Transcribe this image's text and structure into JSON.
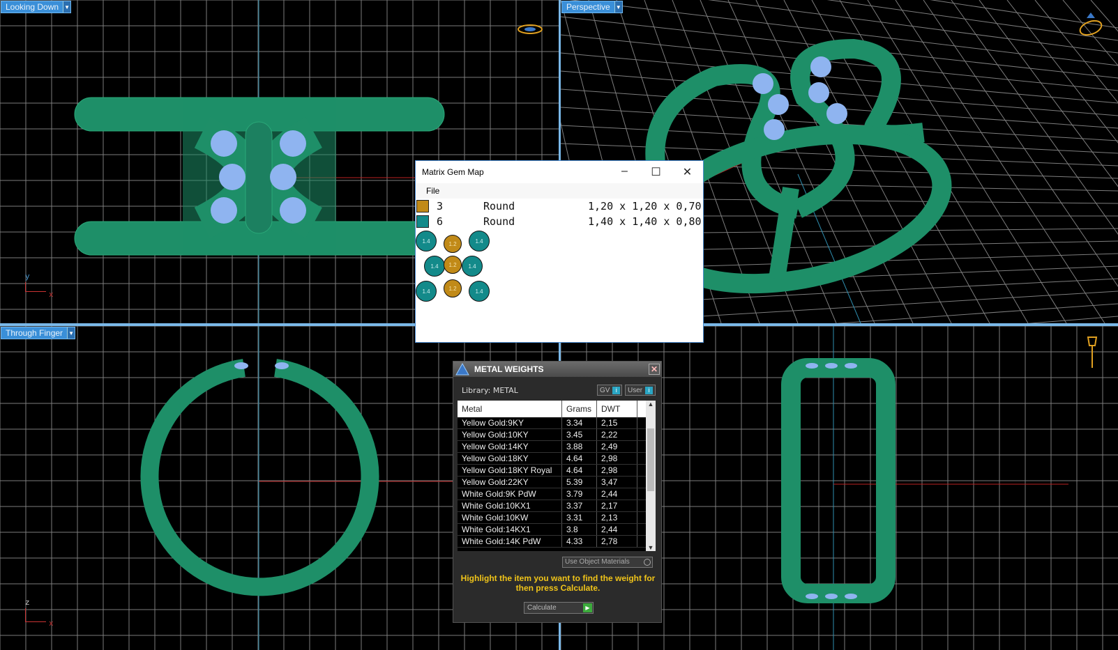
{
  "viewports": {
    "top_left": {
      "label": "Looking Down"
    },
    "top_right": {
      "label": "Perspective"
    },
    "bottom_left": {
      "label": "Through Finger"
    },
    "bottom_right": {
      "label": ""
    }
  },
  "axes": {
    "x": "x",
    "y": "y",
    "z": "z"
  },
  "gem_map": {
    "title": "Matrix Gem Map",
    "menu_file": "File",
    "rows": [
      {
        "count": "3",
        "shape": "Round",
        "dims": "1,20 x 1,20 x 0,70",
        "color": "#c18a18"
      },
      {
        "count": "6",
        "shape": "Round",
        "dims": "1,40 x 1,40 x 0,80",
        "color": "#138a8a"
      }
    ],
    "bubble_small": "1.2",
    "bubble_large": "1.4"
  },
  "metal_weights": {
    "title": "METAL WEIGHTS",
    "library": "Library: METAL",
    "gv_label": "GV",
    "user_label": "User",
    "headers": {
      "metal": "Metal",
      "grams": "Grams",
      "dwt": "DWT"
    },
    "rows": [
      {
        "metal": "Yellow Gold:9KY",
        "grams": "3.34",
        "dwt": "2,15"
      },
      {
        "metal": "Yellow Gold:10KY",
        "grams": "3.45",
        "dwt": "2,22"
      },
      {
        "metal": "Yellow Gold:14KY",
        "grams": "3.88",
        "dwt": "2,49"
      },
      {
        "metal": "Yellow Gold:18KY",
        "grams": "4.64",
        "dwt": "2,98"
      },
      {
        "metal": "Yellow Gold:18KY Royal",
        "grams": "4.64",
        "dwt": "2,98"
      },
      {
        "metal": "Yellow Gold:22KY",
        "grams": "5.39",
        "dwt": "3,47"
      },
      {
        "metal": "White Gold:9K PdW",
        "grams": "3.79",
        "dwt": "2,44"
      },
      {
        "metal": "White Gold:10KX1",
        "grams": "3.37",
        "dwt": "2,17"
      },
      {
        "metal": "White Gold:10KW",
        "grams": "3.31",
        "dwt": "2,13"
      },
      {
        "metal": "White Gold:14KX1",
        "grams": "3.8",
        "dwt": "2,44"
      },
      {
        "metal": "White Gold:14K PdW",
        "grams": "4.33",
        "dwt": "2,78"
      }
    ],
    "use_object_materials": "Use Object Materials",
    "hint": "Highlight the item you want to find the weight for then press Calculate.",
    "calculate": "Calculate"
  },
  "colors": {
    "ring": "#1e8f68",
    "gem": "#8fb4f0",
    "grid": "#7d7d7d",
    "accent": "#3a8fd8"
  }
}
